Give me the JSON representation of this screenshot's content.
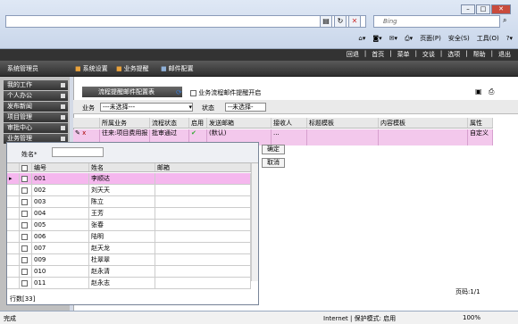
{
  "browser": {
    "search_placeholder": "Bing",
    "cmd": [
      "页面(P)",
      "安全(S)",
      "工具(O)"
    ],
    "status_text": "完成",
    "zone_text": "Internet | 保护模式: 启用",
    "zoom": "100%"
  },
  "app": {
    "top_links": [
      "回退",
      "首页",
      "菜单",
      "交谈",
      "选项",
      "帮助",
      "退出"
    ],
    "nav_title": "系统管理员",
    "nav_tabs": [
      "系统设置",
      "业务提醒",
      "邮件配置"
    ],
    "sidebar": [
      "我的工作",
      "个人办公",
      "发布新闻",
      "项目管理",
      "审批中心",
      "业务管理"
    ]
  },
  "tab": {
    "title": "流程提醒邮件配置表",
    "enable_label": "业务流程邮件提醒开启"
  },
  "filter": {
    "biz_label": "业务",
    "biz_value": "---未选择---",
    "state_label": "状态",
    "state_value": "--未选择-"
  },
  "grid": {
    "headers": [
      "所属业务",
      "流程状态",
      "启用",
      "发送邮箱",
      "接收人",
      "标题模板",
      "内容模板",
      "属性"
    ],
    "row": {
      "biz": "往来:项目费用报",
      "state": "批审通过",
      "mail": "(默认)",
      "recv": "...",
      "attr": "自定义"
    },
    "page": "页码:1/1"
  },
  "popup": {
    "name_label": "姓名*",
    "ok": "确定",
    "cancel": "取消",
    "headers": [
      "编号",
      "姓名",
      "邮箱"
    ],
    "rows": [
      [
        "001",
        "李顺达"
      ],
      [
        "002",
        "刘天天"
      ],
      [
        "003",
        "陈立"
      ],
      [
        "004",
        "王芳"
      ],
      [
        "005",
        "张春"
      ],
      [
        "006",
        "陆明"
      ],
      [
        "007",
        "赵天龙"
      ],
      [
        "009",
        "杜翠翠"
      ],
      [
        "010",
        "赵永清"
      ],
      [
        "011",
        "赵永志"
      ]
    ],
    "count": "行数[33]"
  }
}
